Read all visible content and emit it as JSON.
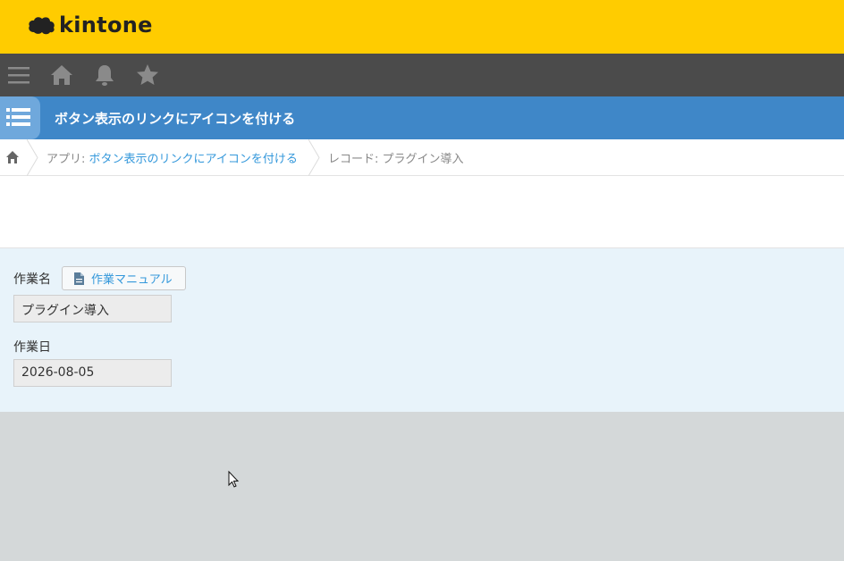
{
  "header": {
    "logo_text": "kintone"
  },
  "nav": {
    "icons": [
      "menu-icon",
      "home-icon",
      "bell-icon",
      "star-icon"
    ]
  },
  "app": {
    "title": "ボタン表示のリンクにアイコンを付ける"
  },
  "breadcrumb": {
    "app_prefix": "アプリ: ",
    "app_name": "ボタン表示のリンクにアイコンを付ける",
    "record_label": "レコード: プラグイン導入"
  },
  "form": {
    "task_name": {
      "label": "作業名",
      "value": "プラグイン導入"
    },
    "manual_button": {
      "label": "作業マニュアル"
    },
    "task_date": {
      "label": "作業日",
      "value": "2026-08-05"
    }
  },
  "colors": {
    "header_yellow": "#ffcc00",
    "nav_dark": "#4b4b4b",
    "app_blue": "#3f87c8",
    "link_blue": "#3498db",
    "form_bg": "#e8f3fa"
  }
}
